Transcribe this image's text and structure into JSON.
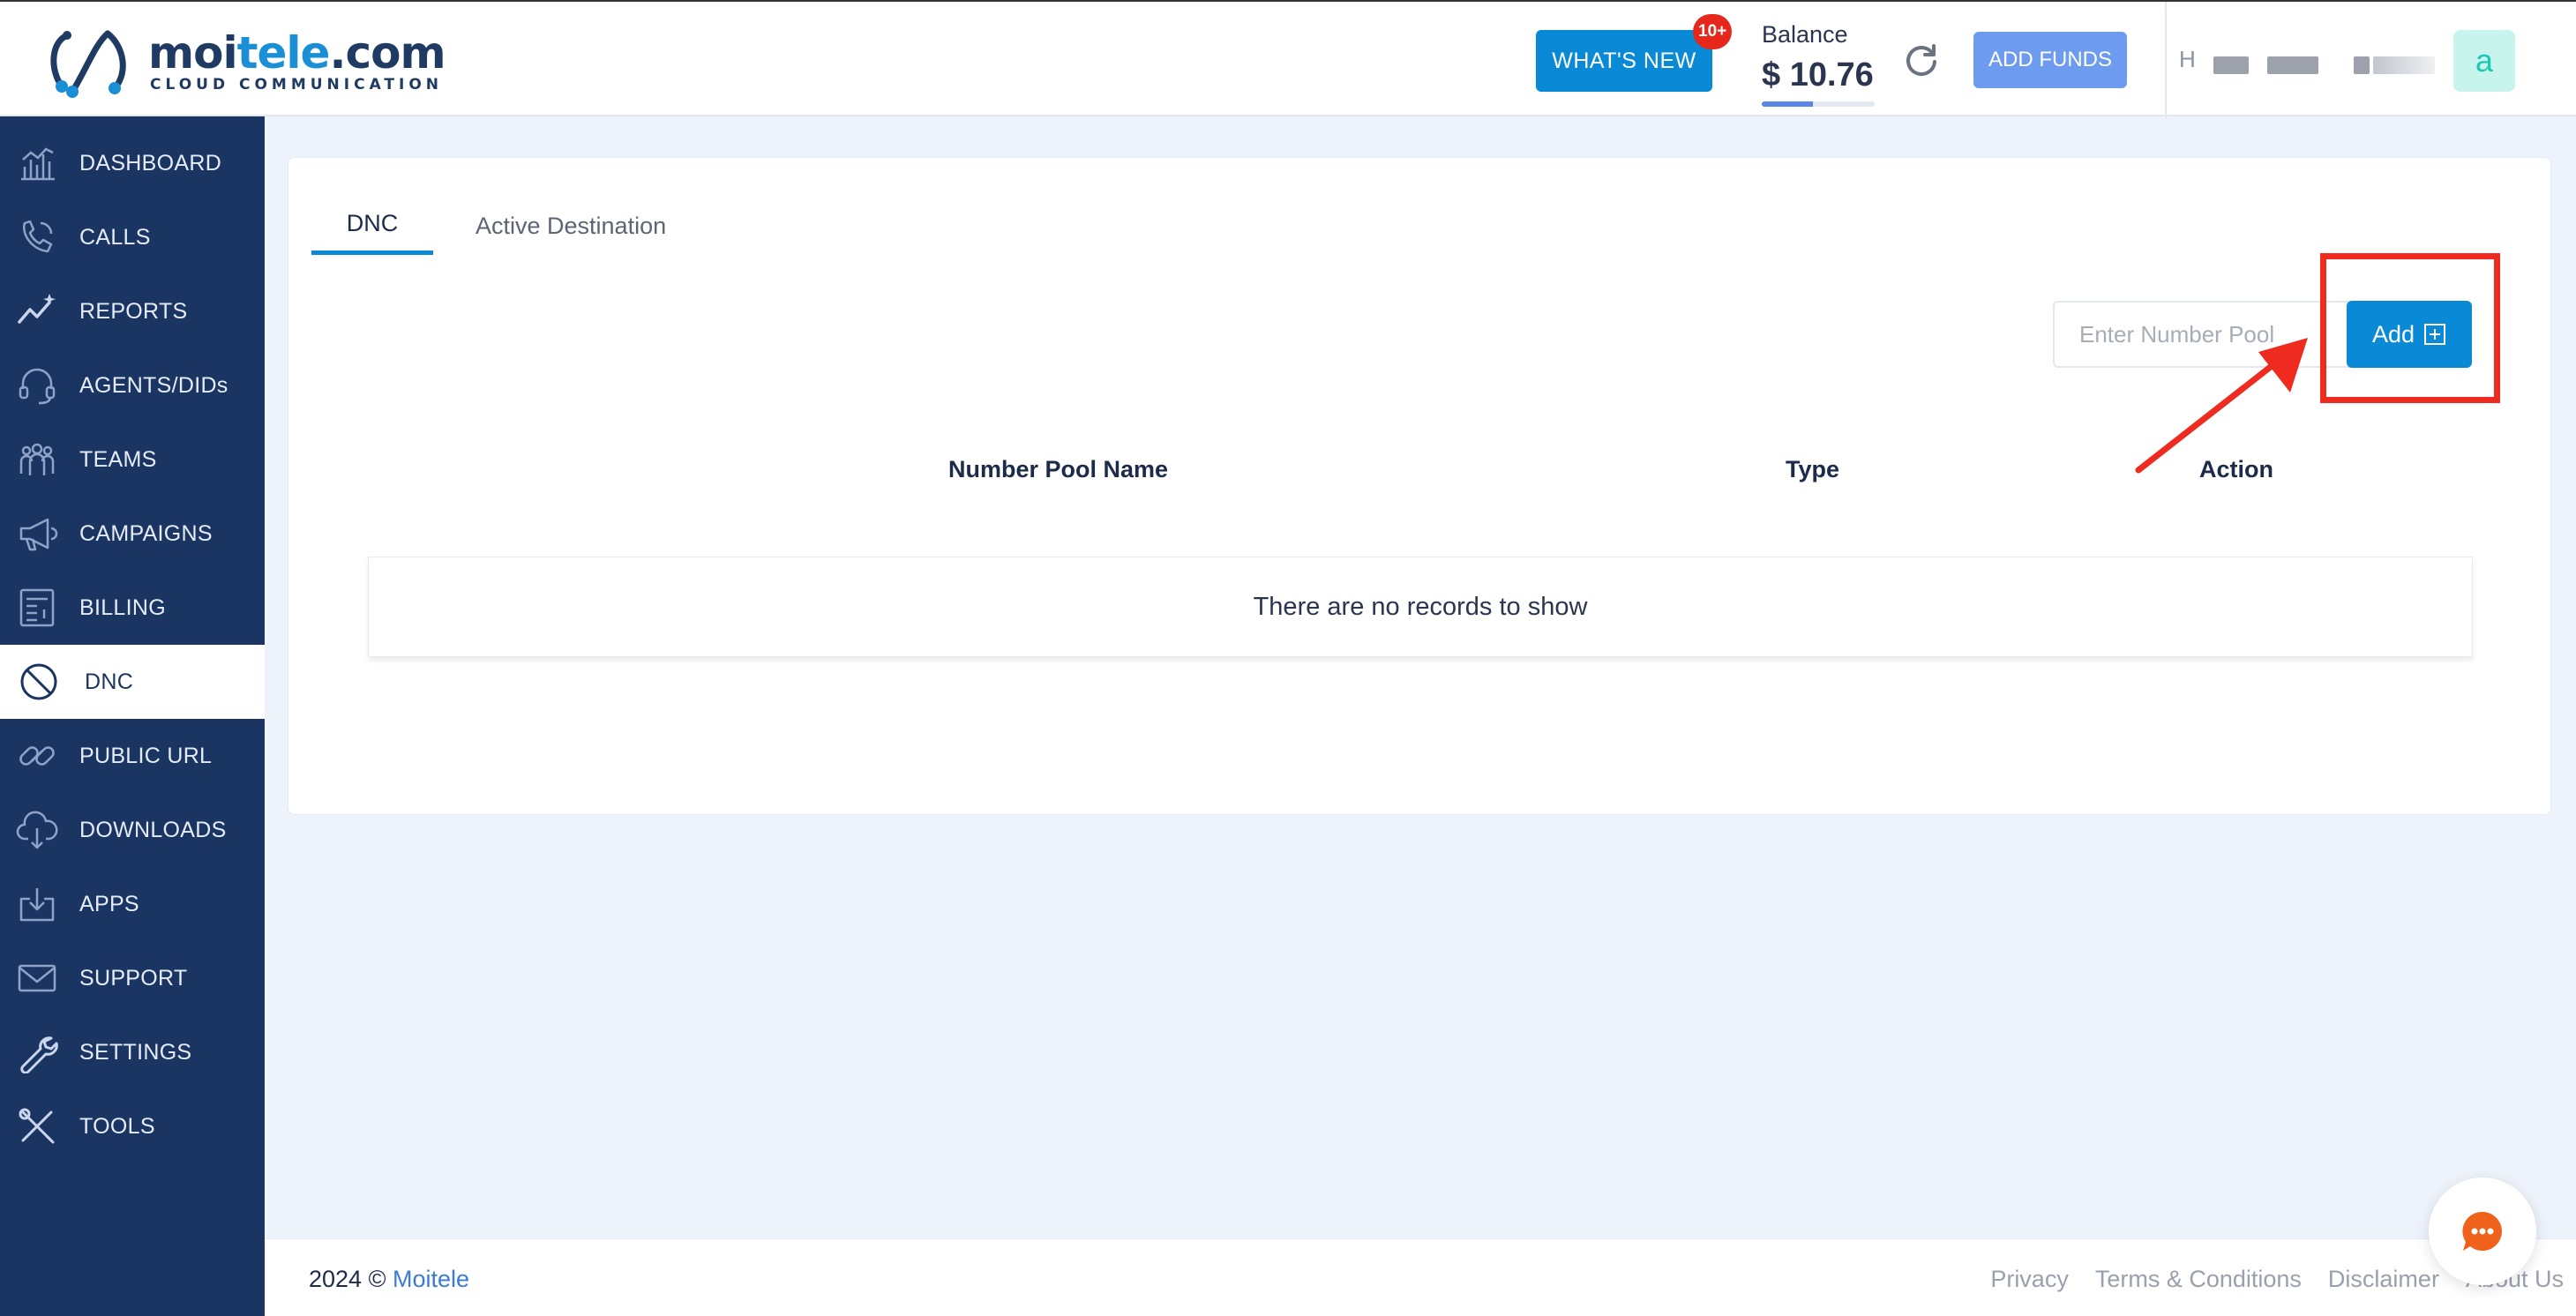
{
  "brand": {
    "name_main": "moi",
    "name_accent": "tele",
    "name_tld": ".com",
    "tagline": "CLOUD COMMUNICATION",
    "accent_color": "#1b8fd6",
    "primary_color": "#1f3a63"
  },
  "header": {
    "whats_new_label": "WHAT'S NEW",
    "whats_new_badge": "10+",
    "balance_label": "Balance",
    "balance_value": "$ 10.76",
    "balance_progress_fraction": 0.45,
    "add_funds_label": "ADD FUNDS",
    "user_initial": "H",
    "avatar_letter": "a",
    "refresh_icon": "refresh-icon"
  },
  "sidebar": {
    "items": [
      {
        "label": "DASHBOARD",
        "icon": "dashboard-icon",
        "active": false
      },
      {
        "label": "CALLS",
        "icon": "phone-icon",
        "active": false
      },
      {
        "label": "REPORTS",
        "icon": "reports-icon",
        "active": false
      },
      {
        "label": "AGENTS/DIDs",
        "icon": "headset-icon",
        "active": false
      },
      {
        "label": "TEAMS",
        "icon": "teams-icon",
        "active": false
      },
      {
        "label": "CAMPAIGNS",
        "icon": "megaphone-icon",
        "active": false
      },
      {
        "label": "BILLING",
        "icon": "billing-icon",
        "active": false
      },
      {
        "label": "DNC",
        "icon": "block-icon",
        "active": true
      },
      {
        "label": "PUBLIC URL",
        "icon": "link-icon",
        "active": false
      },
      {
        "label": "DOWNLOADS",
        "icon": "cloud-download-icon",
        "active": false
      },
      {
        "label": "APPS",
        "icon": "apps-download-icon",
        "active": false
      },
      {
        "label": "SUPPORT",
        "icon": "mail-icon",
        "active": false
      },
      {
        "label": "SETTINGS",
        "icon": "wrench-icon",
        "active": false
      },
      {
        "label": "TOOLS",
        "icon": "tools-icon",
        "active": false
      }
    ]
  },
  "main": {
    "tabs": [
      {
        "label": "DNC",
        "active": true
      },
      {
        "label": "Active Destination",
        "active": false
      }
    ],
    "search": {
      "placeholder": "Enter Number Pool",
      "value": ""
    },
    "add_button_label": "Add",
    "table": {
      "columns": [
        "Number Pool Name",
        "Type",
        "Action"
      ],
      "rows": [],
      "empty_message": "There are no records to show"
    }
  },
  "annotation": {
    "highlight_color": "#ee2b1e"
  },
  "footer": {
    "year_text": "2024 ©",
    "brand_link": "Moitele",
    "links": [
      "Privacy",
      "Terms & Conditions",
      "Disclaimer",
      "About Us"
    ]
  }
}
